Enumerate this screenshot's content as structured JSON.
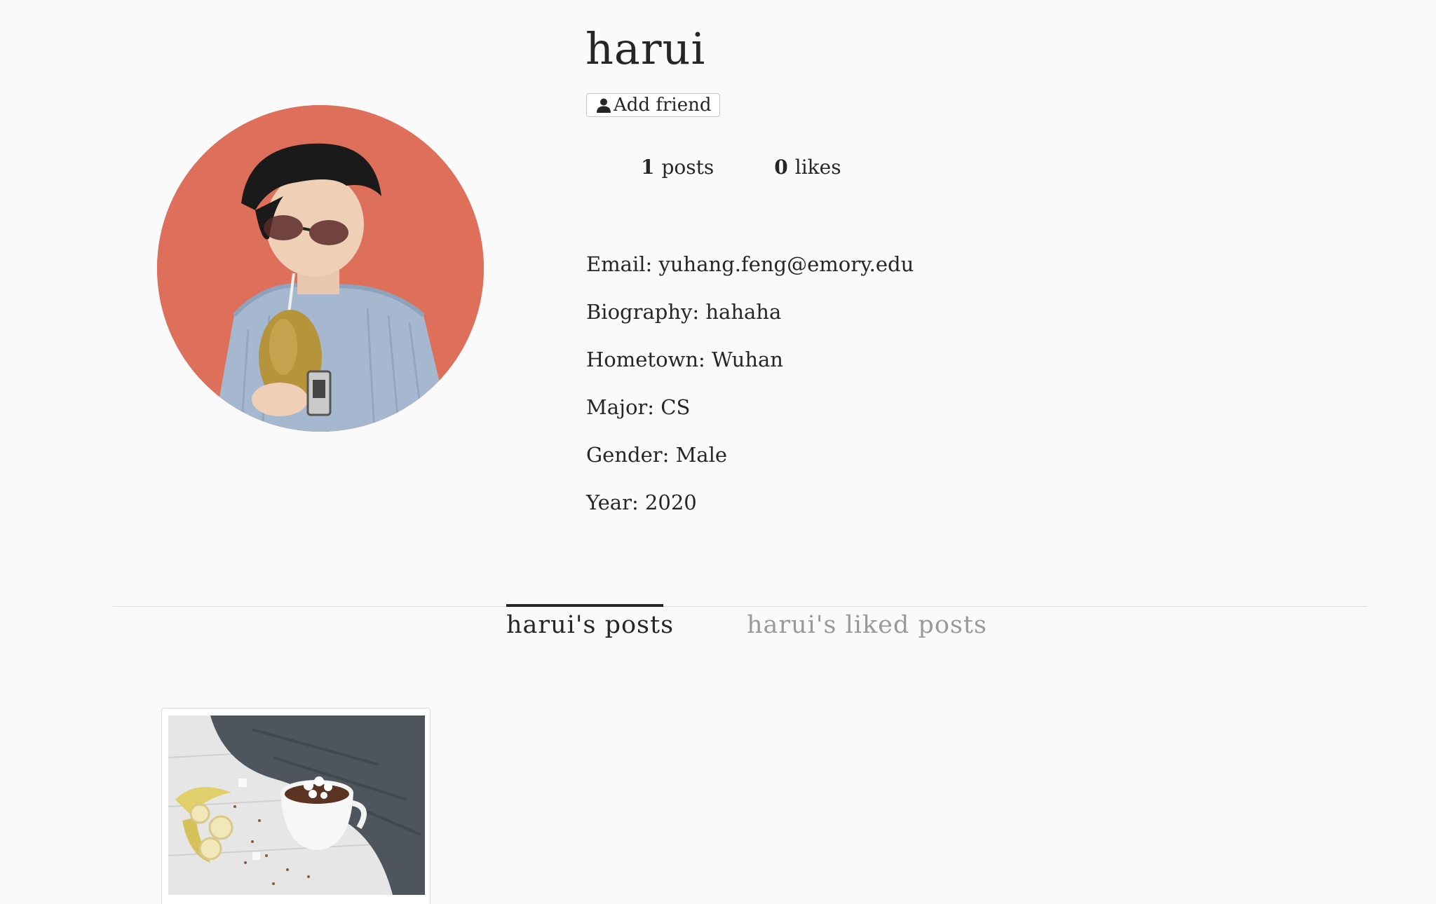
{
  "profile": {
    "username": "harui",
    "add_friend_label": "Add friend",
    "avatar_alt": "profile photo"
  },
  "stats": {
    "posts_count": "1",
    "posts_label": "posts",
    "likes_count": "0",
    "likes_label": "likes"
  },
  "details": {
    "email": "Email: yuhang.feng@emory.edu",
    "biography": "Biography: hahaha",
    "hometown": "Hometown: Wuhan",
    "major": "Major: CS",
    "gender": "Gender: Male",
    "year": "Year: 2020"
  },
  "tabs": {
    "posts": "harui's posts",
    "liked": "harui's liked posts"
  },
  "posts": [
    {
      "thumbnail_alt": "hot chocolate with marshmallows and banana"
    }
  ],
  "colors": {
    "background": "#fafafa",
    "avatar_bg": "#e0735f",
    "text": "#262626",
    "inactive_tab": "#999999",
    "divider": "#dbdbdb"
  },
  "icons": {
    "add_friend": "user-icon"
  }
}
